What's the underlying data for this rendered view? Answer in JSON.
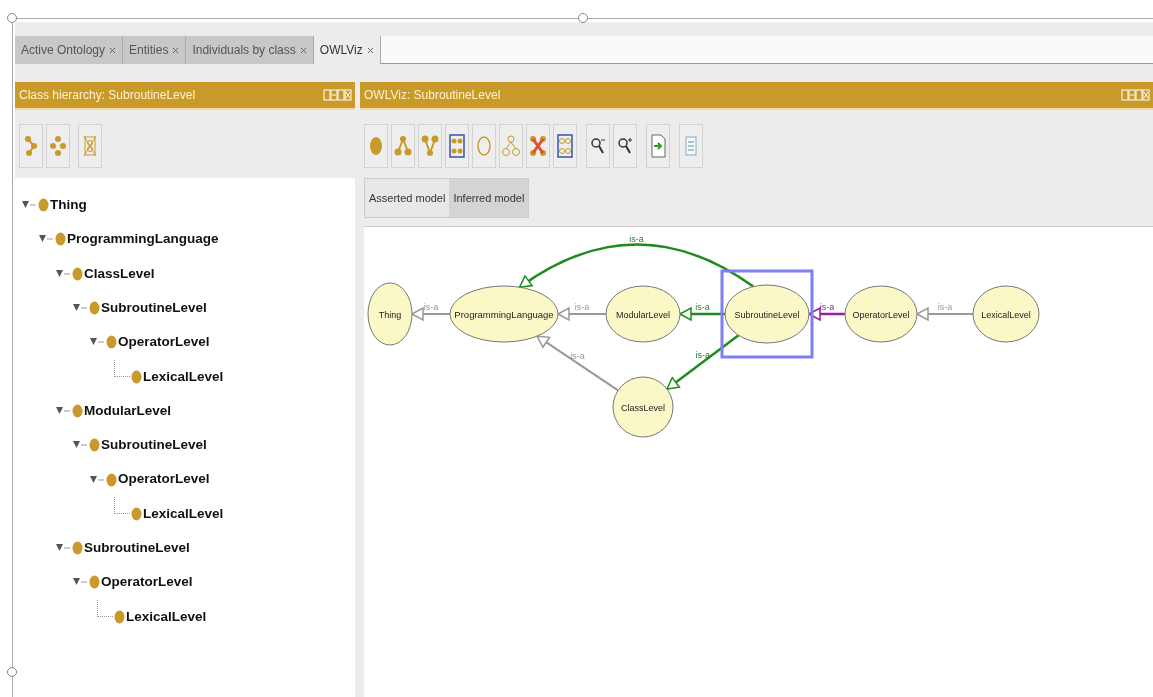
{
  "tabs": [
    {
      "label": "Active Ontology",
      "selected": false
    },
    {
      "label": "Entities",
      "selected": false
    },
    {
      "label": "Individuals by class",
      "selected": false
    },
    {
      "label": "OWLViz",
      "selected": true
    }
  ],
  "class_hierarchy": {
    "title": "Class hierarchy: SubroutineLevel",
    "tree": [
      {
        "label": "Thing",
        "expanded": true,
        "children": [
          {
            "label": "ProgrammingLanguage",
            "expanded": true,
            "children": [
              {
                "label": "ClassLevel",
                "expanded": true,
                "children": [
                  {
                    "label": "SubroutineLevel",
                    "expanded": true,
                    "children": [
                      {
                        "label": "OperatorLevel",
                        "expanded": true,
                        "children": [
                          {
                            "label": "LexicalLevel"
                          }
                        ]
                      }
                    ]
                  }
                ]
              },
              {
                "label": "ModularLevel",
                "expanded": true,
                "children": [
                  {
                    "label": "SubroutineLevel",
                    "expanded": true,
                    "children": [
                      {
                        "label": "OperatorLevel",
                        "expanded": true,
                        "children": [
                          {
                            "label": "LexicalLevel"
                          }
                        ]
                      }
                    ]
                  }
                ]
              },
              {
                "label": "SubroutineLevel",
                "expanded": true,
                "children": [
                  {
                    "label": "OperatorLevel",
                    "expanded": true,
                    "children": [
                      {
                        "label": "LexicalLevel"
                      }
                    ]
                  }
                ]
              }
            ]
          }
        ]
      }
    ]
  },
  "owlviz": {
    "title": "OWLViz: SubroutineLevel",
    "model_tabs": [
      {
        "label": "Asserted model",
        "selected": true
      },
      {
        "label": "Inferred model",
        "selected": false
      }
    ],
    "nodes": [
      {
        "label": "Thing",
        "selected": false
      },
      {
        "label": "ProgrammingLanguage",
        "selected": false
      },
      {
        "label": "ModularLevel",
        "selected": false
      },
      {
        "label": "SubroutineLevel",
        "selected": true
      },
      {
        "label": "OperatorLevel",
        "selected": false
      },
      {
        "label": "LexicalLevel",
        "selected": false
      },
      {
        "label": "ClassLevel",
        "selected": false
      }
    ],
    "edges": [
      {
        "label": "is-a",
        "color": "#999999"
      },
      {
        "label": "is-a",
        "color": "#999999"
      },
      {
        "label": "is-a",
        "color": "#999999"
      },
      {
        "label": "is-a",
        "color": "#1f8a1f"
      },
      {
        "label": "is-a",
        "color": "#1f8a1f"
      },
      {
        "label": "is-a",
        "color": "#1f8a1f"
      },
      {
        "label": "is-a",
        "color": "#9b1f9b"
      },
      {
        "label": "is-a",
        "color": "#999999"
      }
    ]
  }
}
